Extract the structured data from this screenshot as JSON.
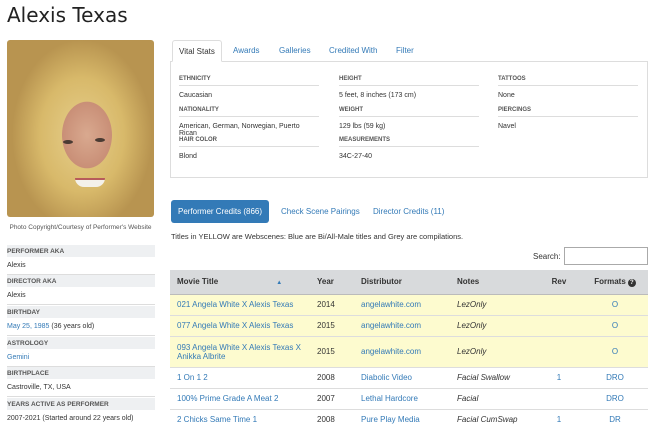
{
  "page_title": "Alexis Texas",
  "photo_caption": "Photo Copyright/Courtesy of Performer's Website",
  "sidebar": [
    {
      "label": "PERFORMER AKA",
      "value": "Alexis",
      "link": ""
    },
    {
      "label": "DIRECTOR AKA",
      "value": "Alexis",
      "link": ""
    },
    {
      "label": "BIRTHDAY",
      "value": "(36 years old)",
      "link": "May 25, 1985"
    },
    {
      "label": "ASTROLOGY",
      "value": "",
      "link": "Gemini"
    },
    {
      "label": "BIRTHPLACE",
      "value": "Castroville, TX, USA",
      "link": ""
    },
    {
      "label": "YEARS ACTIVE AS PERFORMER",
      "value": "2007-2021 (Started around 22 years old)",
      "link": ""
    }
  ],
  "tabs": [
    "Vital Stats",
    "Awards",
    "Galleries",
    "Credited With",
    "Filter"
  ],
  "stats": [
    {
      "label": "ETHNICITY",
      "value": "Caucasian"
    },
    {
      "label": "NATIONALITY",
      "value": "American, German, Norwegian, Puerto Rican"
    },
    {
      "label": "HAIR COLOR",
      "value": "Blond"
    },
    {
      "label": "HEIGHT",
      "value": "5 feet, 8 inches (173 cm)"
    },
    {
      "label": "WEIGHT",
      "value": "129 lbs (59 kg)"
    },
    {
      "label": "MEASUREMENTS",
      "value": "34C-27-40"
    },
    {
      "label": "TATTOOS",
      "value": "None"
    },
    {
      "label": "PIERCINGS",
      "value": "Navel"
    }
  ],
  "credit_tabs": [
    "Performer Credits (866)",
    "Check Scene Pairings",
    "Director Credits (11)"
  ],
  "note": "Titles in YELLOW are Webscenes: Blue are Bi/All-Male titles and Grey are compilations.",
  "search_label": "Search:",
  "table": {
    "headers": [
      "Movie Title",
      "Year",
      "Distributor",
      "Notes",
      "Rev",
      "Formats"
    ],
    "sort_indicator": "▲",
    "help_icon": "?",
    "rows": [
      {
        "title": "021 Angela White X Alexis Texas",
        "year": "2014",
        "distributor": "angelawhite.com",
        "notes": "LezOnly",
        "rev": "",
        "formats": "O",
        "web": true
      },
      {
        "title": "077 Angela White X Alexis Texas",
        "year": "2015",
        "distributor": "angelawhite.com",
        "notes": "LezOnly",
        "rev": "",
        "formats": "O",
        "web": true
      },
      {
        "title": "093 Angela White X Alexis Texas X Anikka Albrite",
        "year": "2015",
        "distributor": "angelawhite.com",
        "notes": "LezOnly",
        "rev": "",
        "formats": "O",
        "web": true
      },
      {
        "title": "1 On 1 2",
        "year": "2008",
        "distributor": "Diabolic Video",
        "notes": "Facial Swallow",
        "rev": "1",
        "formats": "DRO",
        "web": false
      },
      {
        "title": "100% Prime Grade A Meat 2",
        "year": "2007",
        "distributor": "Lethal Hardcore",
        "notes": "Facial",
        "rev": "",
        "formats": "DRO",
        "web": false
      },
      {
        "title": "2 Chicks Same Time 1",
        "year": "2008",
        "distributor": "Pure Play Media",
        "notes": "Facial CumSwap",
        "rev": "1",
        "formats": "DR",
        "web": false
      }
    ]
  }
}
